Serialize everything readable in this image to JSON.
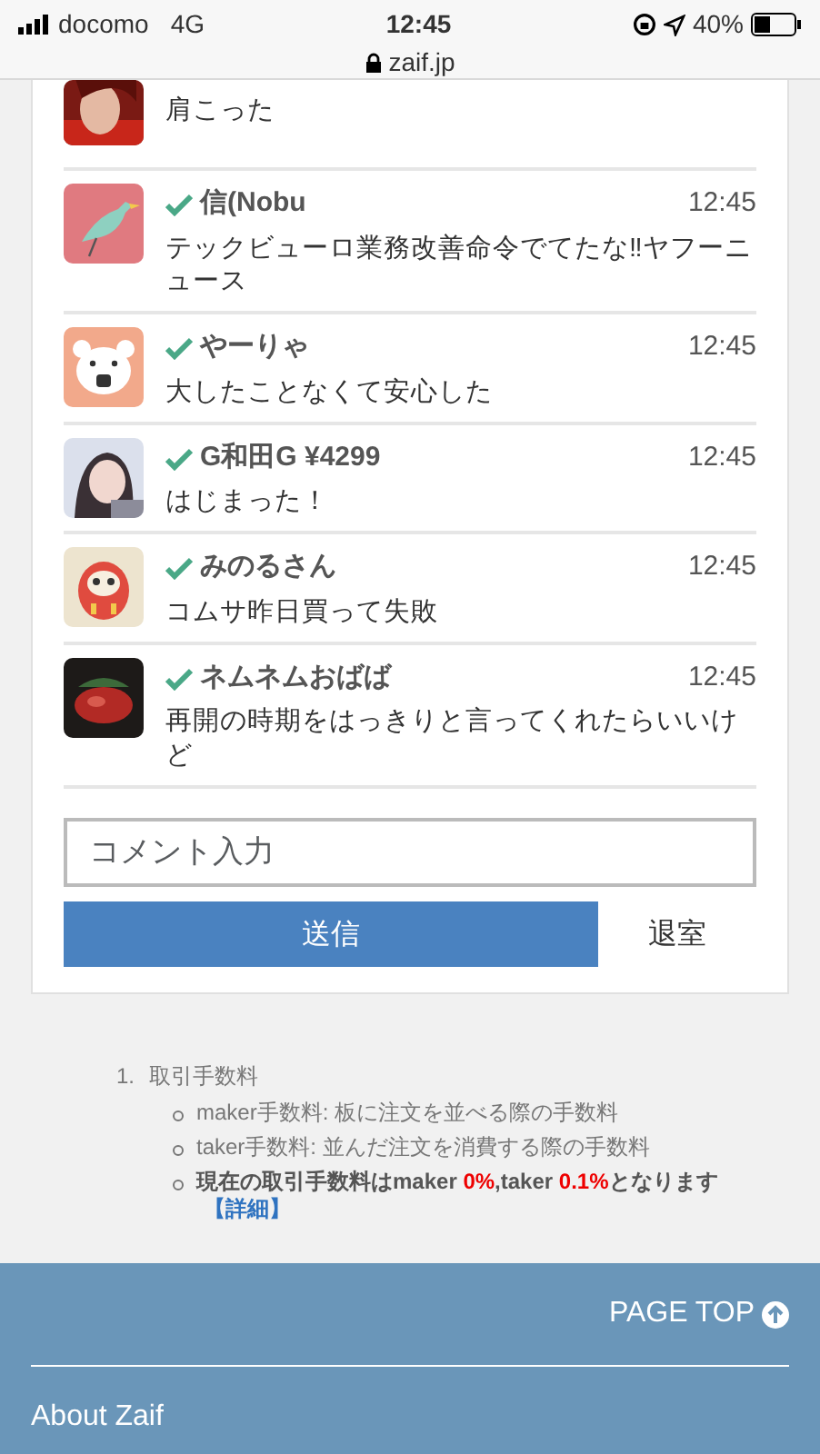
{
  "status_bar": {
    "carrier": "docomo",
    "network": "4G",
    "time": "12:45",
    "battery": "40%",
    "url": "zaif.jp"
  },
  "messages": [
    {
      "kind": "partial",
      "text": "肩こった"
    },
    {
      "kind": "full",
      "verified": true,
      "name": "信(Nobu",
      "time": "12:45",
      "text": "テックビューロ業務改善命令でてたな‼ヤフーニュース"
    },
    {
      "kind": "full",
      "verified": true,
      "name": "やーりゃ",
      "time": "12:45",
      "text": "大したことなくて安心した"
    },
    {
      "kind": "full",
      "verified": true,
      "name": "G和田G ¥4299",
      "time": "12:45",
      "text": "はじまった！"
    },
    {
      "kind": "full",
      "verified": true,
      "name": "みのるさん",
      "time": "12:45",
      "text": "コムサ昨日買って失敗"
    },
    {
      "kind": "full",
      "verified": true,
      "name": "ネムネムおばば",
      "time": "12:45",
      "text": "再開の時期をはっきりと言ってくれたらいいけど"
    }
  ],
  "comment": {
    "placeholder": "コメント入力",
    "send": "送信",
    "leave": "退室"
  },
  "notes": {
    "number": "1.",
    "title": "取引手数料",
    "items": [
      {
        "segments": [
          {
            "text": "maker手数料: 板に注文を並べる際の手数料",
            "highlight": false
          }
        ],
        "bold": false
      },
      {
        "segments": [
          {
            "text": "taker手数料: 並んだ注文を消費する際の手数料",
            "highlight": false
          }
        ],
        "bold": false
      },
      {
        "segments": [
          {
            "text": "現在の取引手数料はmaker ",
            "highlight": false
          },
          {
            "text": "0%",
            "highlight": true
          },
          {
            "text": ",taker ",
            "highlight": false
          },
          {
            "text": "0.1%",
            "highlight": true
          },
          {
            "text": "となります",
            "highlight": false
          }
        ],
        "bold": true,
        "link": "【詳細】"
      }
    ]
  },
  "footer": {
    "page_top": "PAGE TOP",
    "links": [
      "About Zaif"
    ]
  }
}
